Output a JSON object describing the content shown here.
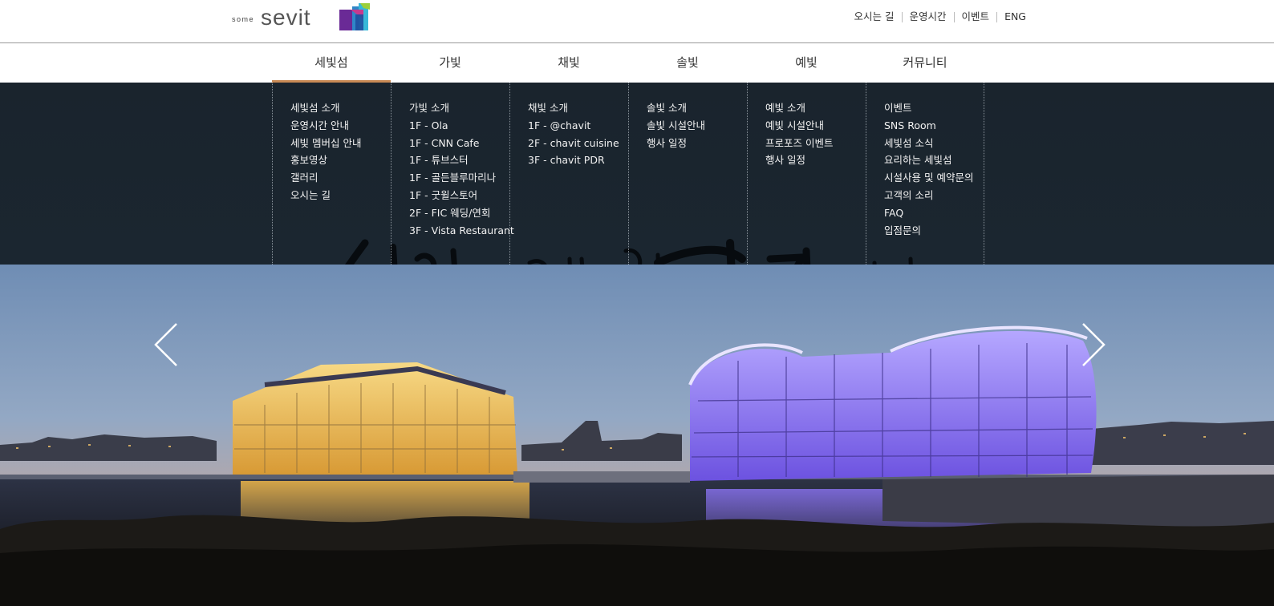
{
  "brand": {
    "logo_some": "some",
    "logo_sevit": "sevit"
  },
  "util_nav": [
    "오시는 길",
    "운영시간",
    "이벤트",
    "ENG"
  ],
  "gnb": [
    {
      "label": "세빛섬",
      "active": true
    },
    {
      "label": "가빛",
      "active": false
    },
    {
      "label": "채빛",
      "active": false
    },
    {
      "label": "솔빛",
      "active": false
    },
    {
      "label": "예빛",
      "active": false
    },
    {
      "label": "커뮤니티",
      "active": false
    }
  ],
  "submenu": [
    [
      "세빛섬 소개",
      "운영시간 안내",
      "세빛 멤버십 안내",
      "홍보영상",
      "갤러리",
      "오시는 길"
    ],
    [
      "가빛 소개",
      "1F - Ola",
      "1F - CNN Cafe",
      "1F - 튜브스터",
      "1F - 골든블루마리나",
      "1F - 굿윌스토어",
      "2F - FIC 웨딩/연회",
      "3F - Vista Restaurant"
    ],
    [
      "채빛 소개",
      "1F - @chavit",
      "2F - chavit cuisine",
      "3F - chavit PDR"
    ],
    [
      "솔빛 소개",
      "솔빛 시설안내",
      "행사 일정"
    ],
    [
      "예빛 소개",
      "예빛 시설안내",
      "프로포즈 이벤트",
      "행사 일정"
    ],
    [
      "이벤트",
      "SNS Room",
      "세빛섬 소식",
      "요리하는 세빛섬",
      "시설사용 및 예약문의",
      "고객의 소리",
      "FAQ",
      "입점문의"
    ]
  ],
  "calligraphy_text": "세상에 단 하나뿐인 한강을 만나다",
  "colors": {
    "accent": "#c98a55",
    "menu_bg": "#1a242d",
    "sky_top": "#6f8db4",
    "building_purple": "#8f7af0",
    "building_gold": "#f0c25a"
  },
  "icons": {
    "prev": "chevron-left-icon",
    "next": "chevron-right-icon"
  }
}
